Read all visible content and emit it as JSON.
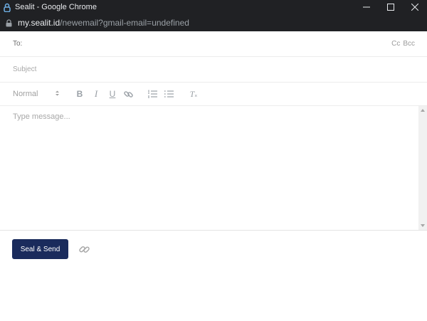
{
  "window": {
    "title": "Sealit - Google Chrome",
    "url_host": "my.sealit.id",
    "url_path": "/newemail?gmail-email=undefined"
  },
  "compose": {
    "to_label": "To:",
    "to_value": "",
    "cc_label": "Cc",
    "bcc_label": "Bcc",
    "subject_placeholder": "Subject",
    "subject_value": "",
    "format_select": "Normal",
    "message_placeholder": "Type message...",
    "send_label": "Seal & Send"
  },
  "toolbar": {
    "bold": "B",
    "italic": "I",
    "underline": "U",
    "clear_format": "T"
  },
  "colors": {
    "chrome_bar": "#202124",
    "send_button": "#1a2b5c",
    "toolbar_icon": "#9aa0a6"
  }
}
